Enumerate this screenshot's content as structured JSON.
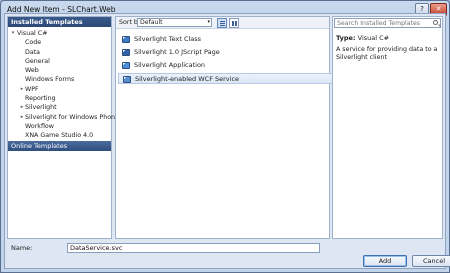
{
  "window": {
    "title": "Add New Item - SLChart.Web",
    "help_label": "?",
    "close_label": "✕"
  },
  "left_pane": {
    "header": "Installed Templates",
    "tree": [
      {
        "label": "Visual C#",
        "level": 0,
        "expand": "▾"
      },
      {
        "label": "Code",
        "level": 1,
        "expand": ""
      },
      {
        "label": "Data",
        "level": 1,
        "expand": ""
      },
      {
        "label": "General",
        "level": 1,
        "expand": ""
      },
      {
        "label": "Web",
        "level": 1,
        "expand": ""
      },
      {
        "label": "Windows Forms",
        "level": 1,
        "expand": ""
      },
      {
        "label": "WPF",
        "level": 1,
        "expand": "▸"
      },
      {
        "label": "Reporting",
        "level": 1,
        "expand": ""
      },
      {
        "label": "Silverlight",
        "level": 1,
        "expand": "▸"
      },
      {
        "label": "Silverlight for Windows Phone",
        "level": 1,
        "expand": "▸"
      },
      {
        "label": "Workflow",
        "level": 1,
        "expand": ""
      },
      {
        "label": "XNA Game Studio 4.0",
        "level": 1,
        "expand": ""
      }
    ],
    "online": "Online Templates"
  },
  "middle_pane": {
    "sort_label": "Sort by:",
    "sort_value": "Default",
    "sort_caret": "▾",
    "templates": [
      {
        "label": "Silverlight Text Class",
        "color": "#3b7bc8",
        "selected": false
      },
      {
        "label": "Silverlight 1.0 JScript Page",
        "color": "#2f62a6",
        "selected": false
      },
      {
        "label": "Silverlight Application",
        "color": "#4a8fd8",
        "selected": false
      },
      {
        "label": "Silverlight-enabled WCF Service",
        "color": "#5a8fcf",
        "selected": true
      }
    ]
  },
  "right_pane": {
    "search_placeholder": "Search Installed Templates",
    "type_label": "Type:",
    "type_value": "Visual C#",
    "description": "A service for providing data to a Silverlight client"
  },
  "bottom": {
    "name_label": "Name:",
    "name_value": "DataService.svc",
    "add_label": "Add",
    "cancel_label": "Cancel"
  }
}
